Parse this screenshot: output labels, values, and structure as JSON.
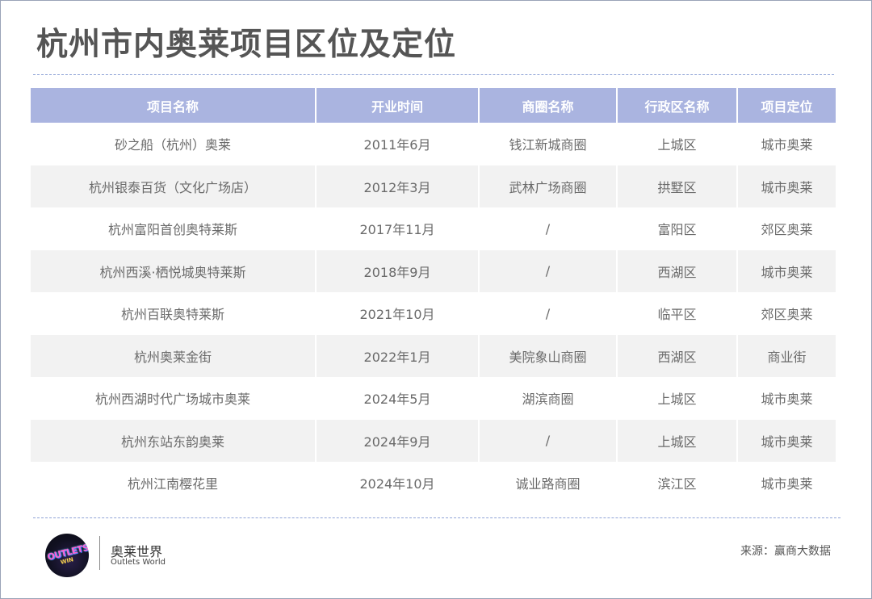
{
  "title": "杭州市内奥莱项目区位及定位",
  "table": {
    "headers": [
      "项目名称",
      "开业时间",
      "商圈名称",
      "行政区名称",
      "项目定位"
    ],
    "rows": [
      [
        "砂之船（杭州）奥莱",
        "2011年6月",
        "钱江新城商圈",
        "上城区",
        "城市奥莱"
      ],
      [
        "杭州银泰百货（文化广场店）",
        "2012年3月",
        "武林广场商圈",
        "拱墅区",
        "城市奥莱"
      ],
      [
        "杭州富阳首创奥特莱斯",
        "2017年11月",
        "/",
        "富阳区",
        "郊区奥莱"
      ],
      [
        "杭州西溪·栖悦城奥特莱斯",
        "2018年9月",
        "/",
        "西湖区",
        "城市奥莱"
      ],
      [
        "杭州百联奥特莱斯",
        "2021年10月",
        "/",
        "临平区",
        "郊区奥莱"
      ],
      [
        "杭州奥莱金街",
        "2022年1月",
        "美院象山商圈",
        "西湖区",
        "商业街"
      ],
      [
        "杭州西湖时代广场城市奥莱",
        "2024年5月",
        "湖滨商圈",
        "上城区",
        "城市奥莱"
      ],
      [
        "杭州东站东韵奥莱",
        "2024年9月",
        "/",
        "上城区",
        "城市奥莱"
      ],
      [
        "杭州江南樱花里",
        "2024年10月",
        "诚业路商圈",
        "滨江区",
        "城市奥莱"
      ]
    ]
  },
  "footer": {
    "logo_text": "OUTLETS",
    "logo_sub": "WIN",
    "brand_cn": "奥莱世界",
    "brand_en": "Outlets World",
    "source": "来源：赢商大数据"
  },
  "colors": {
    "header_bg": "#aab4e0",
    "row_alt_bg": "#f2f2f2",
    "divider": "#8fa3d6"
  }
}
